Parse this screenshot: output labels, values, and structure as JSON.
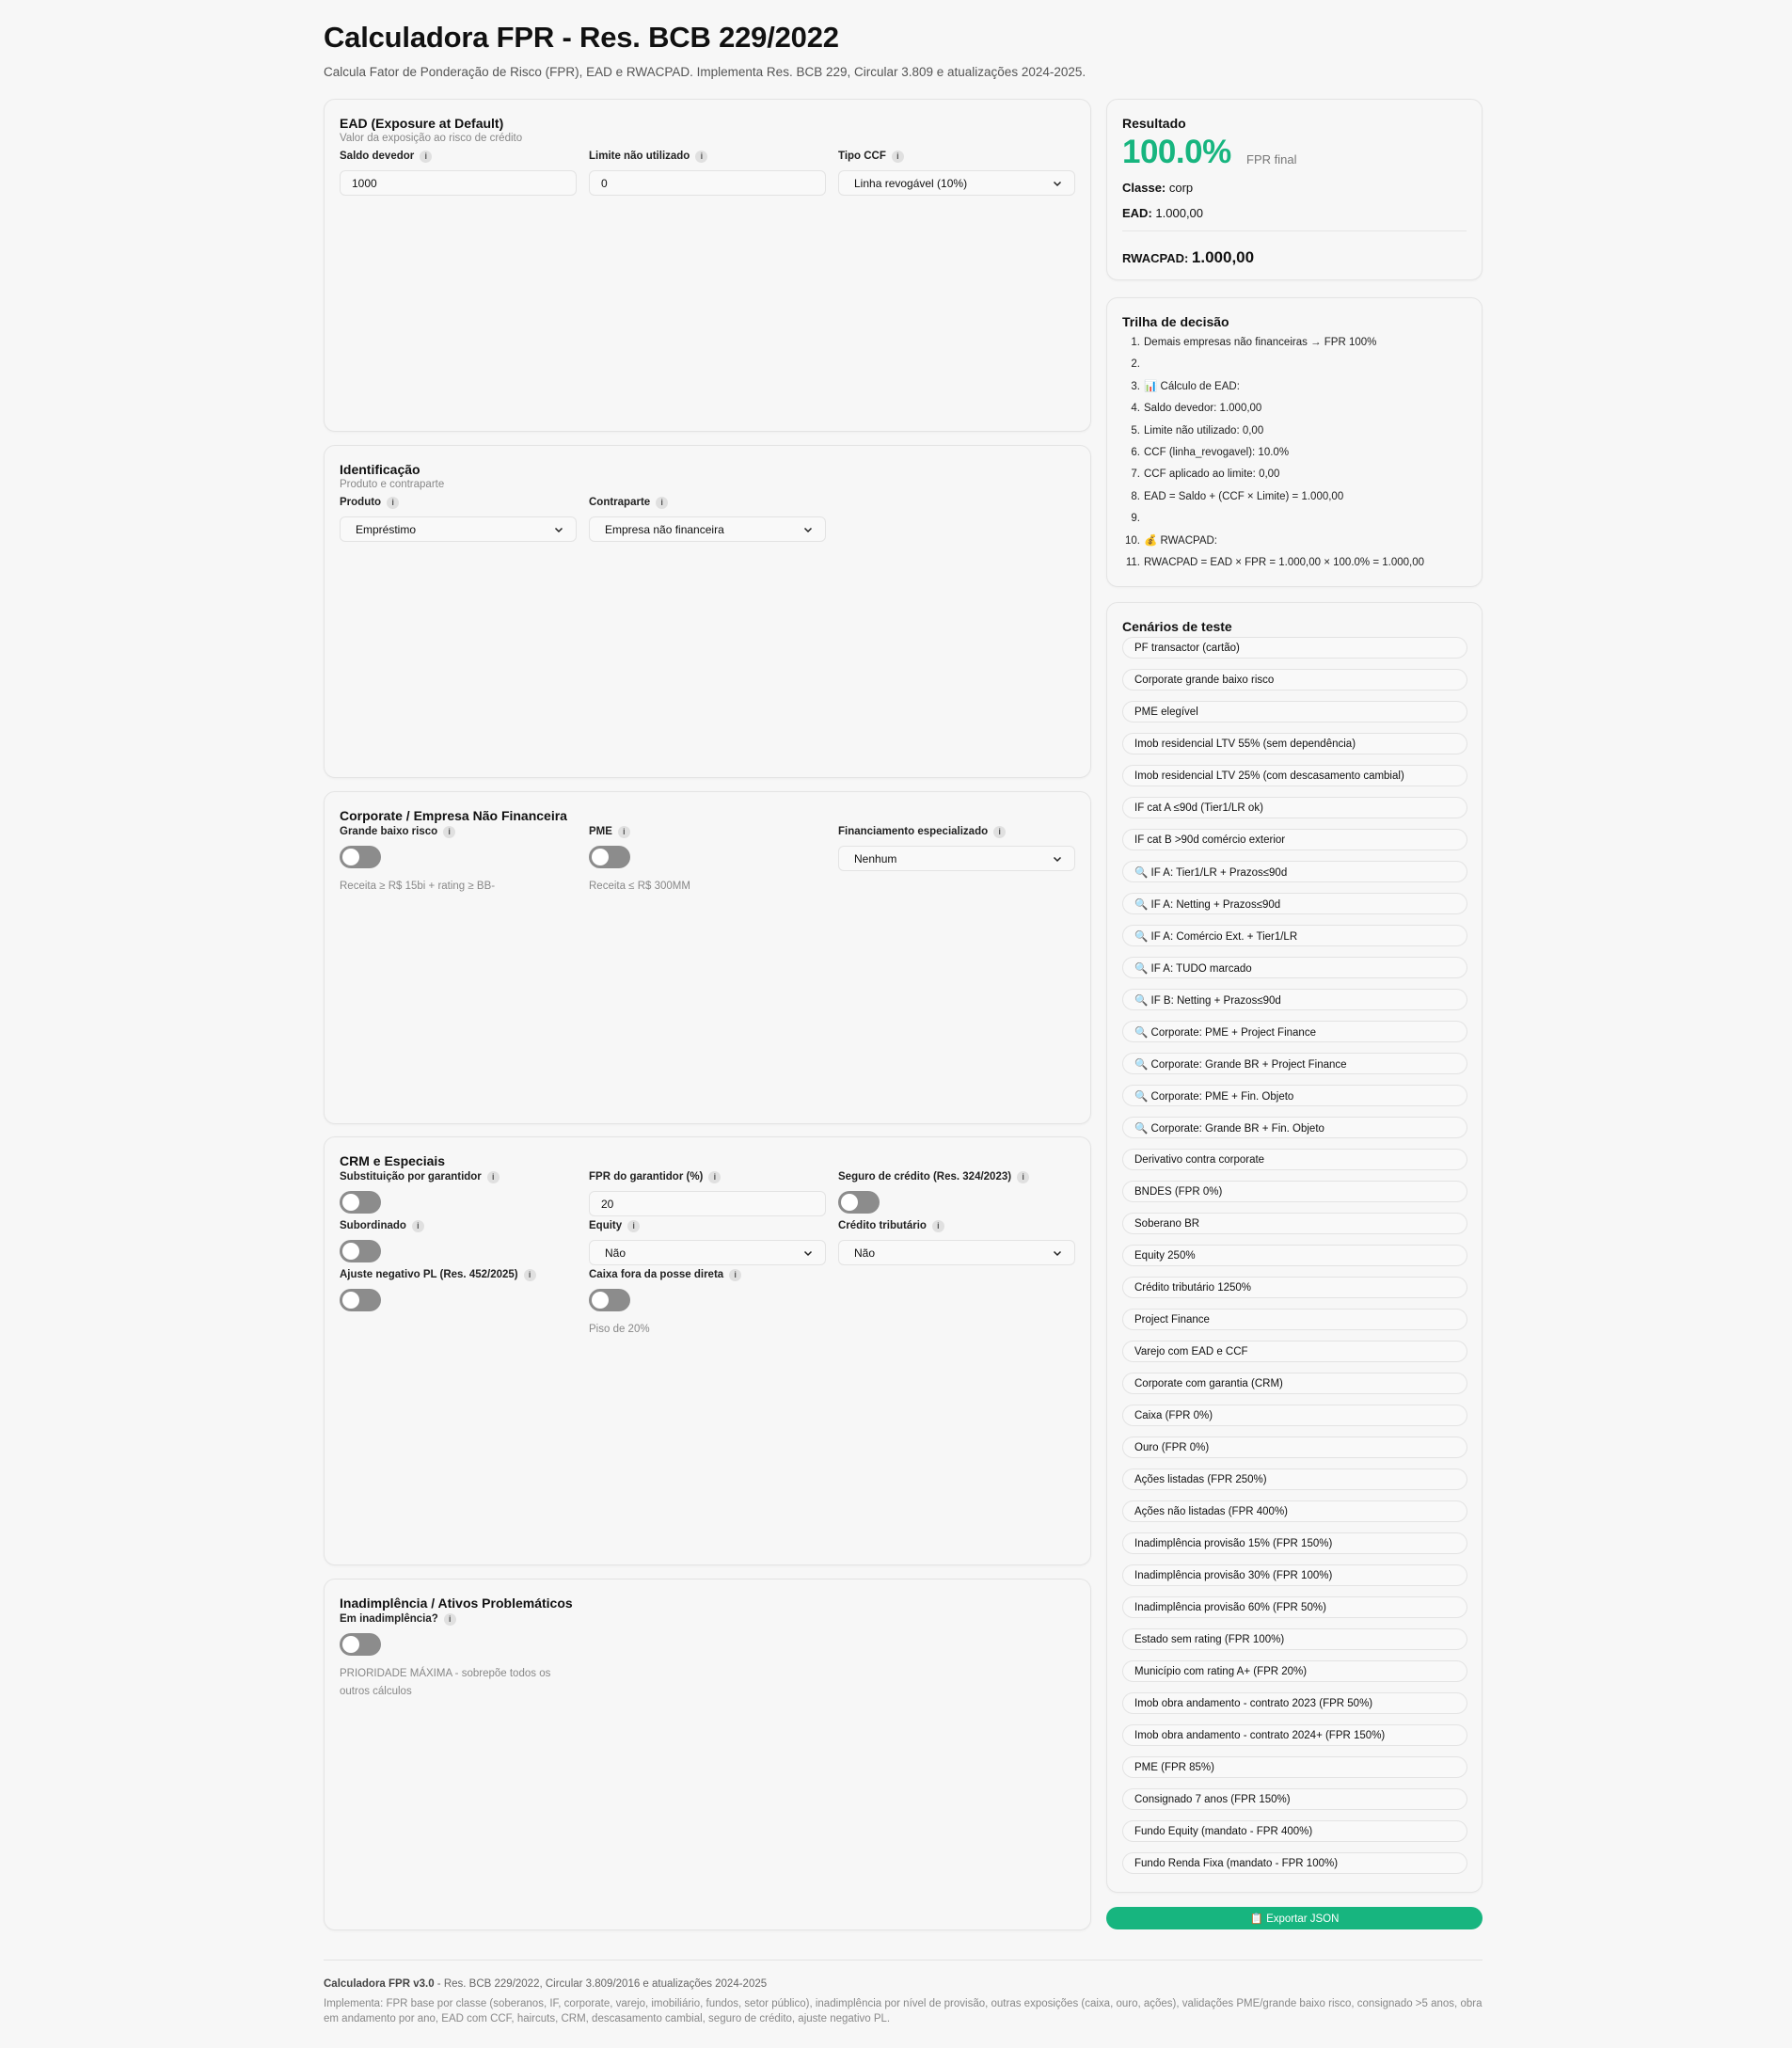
{
  "header": {
    "title": "Calculadora FPR - Res. BCB 229/2022",
    "subtitle": "Calcula Fator de Ponderação de Risco (FPR), EAD e RWACPAD. Implementa Res. BCB 229, Circular 3.809 e atualizações 2024-2025."
  },
  "ead": {
    "title": "EAD (Exposure at Default)",
    "subtitle": "Valor da exposição ao risco de crédito",
    "saldo_label": "Saldo devedor",
    "saldo_value": "1000",
    "limite_label": "Limite não utilizado",
    "limite_value": "0",
    "ccf_label": "Tipo CCF",
    "ccf_value": "Linha revogável (10%)"
  },
  "identificacao": {
    "title": "Identificação",
    "subtitle": "Produto e contraparte",
    "produto_label": "Produto",
    "produto_value": "Empréstimo",
    "contraparte_label": "Contraparte",
    "contraparte_value": "Empresa não financeira"
  },
  "corporate": {
    "title": "Corporate / Empresa Não Financeira",
    "gbr_label": "Grande baixo risco",
    "gbr_hint": "Receita ≥ R$ 15bi + rating ≥ BB-",
    "gbr_on": false,
    "pme_label": "PME",
    "pme_hint": "Receita ≤ R$ 300MM",
    "pme_on": false,
    "fin_label": "Financiamento especializado",
    "fin_value": "Nenhum"
  },
  "crm": {
    "title": "CRM e Especiais",
    "garantidor_label": "Substituição por garantidor",
    "fpr_garantidor_label": "FPR do garantidor (%)",
    "fpr_garantidor_value": "20",
    "seguro_label": "Seguro de crédito (Res. 324/2023)",
    "subordinado_label": "Subordinado",
    "equity_label": "Equity",
    "equity_value": "Não",
    "credito_label": "Crédito tributário",
    "credito_value": "Não",
    "ajuste_label": "Ajuste negativo PL (Res. 452/2025)",
    "caixa_label": "Caixa fora da posse direta",
    "caixa_hint": "Piso de 20%"
  },
  "inadimplencia": {
    "title": "Inadimplência / Ativos Problemáticos",
    "label": "Em inadimplência?",
    "hint": "PRIORIDADE MÁXIMA - sobrepõe todos os outros cálculos"
  },
  "resultado": {
    "title": "Resultado",
    "fpr": "100.0%",
    "fpr_note": "FPR final",
    "classe_label": "Classe:",
    "classe_value": "corp",
    "ead_label": "EAD:",
    "ead_value": "1.000,00",
    "rwacpad_label": "RWACPAD:",
    "rwacpad_value": "1.000,00"
  },
  "trilha": {
    "title": "Trilha de decisão",
    "steps": [
      {
        "n": "1.",
        "t": "Demais empresas não financeiras → FPR 100%"
      },
      {
        "n": "2.",
        "t": ""
      },
      {
        "n": "3.",
        "t": "📊 Cálculo de EAD:"
      },
      {
        "n": "4.",
        "t": "Saldo devedor: 1.000,00"
      },
      {
        "n": "5.",
        "t": "Limite não utilizado: 0,00"
      },
      {
        "n": "6.",
        "t": "CCF (linha_revogavel): 10.0%"
      },
      {
        "n": "7.",
        "t": "CCF aplicado ao limite: 0,00"
      },
      {
        "n": "8.",
        "t": "EAD = Saldo + (CCF × Limite) = 1.000,00"
      },
      {
        "n": "9.",
        "t": ""
      },
      {
        "n": "10.",
        "t": "💰 RWACPAD:"
      },
      {
        "n": "11.",
        "t": "RWACPAD = EAD × FPR = 1.000,00 × 100.0% = 1.000,00"
      }
    ]
  },
  "cenarios": {
    "title": "Cenários de teste",
    "items": [
      "PF transactor (cartão)",
      "Corporate grande baixo risco",
      "PME elegível",
      "Imob residencial LTV 55% (sem dependência)",
      "Imob residencial LTV 25% (com descasamento cambial)",
      "IF cat A ≤90d (Tier1/LR ok)",
      "IF cat B >90d comércio exterior",
      "🔍 IF A: Tier1/LR + Prazos≤90d",
      "🔍 IF A: Netting + Prazos≤90d",
      "🔍 IF A: Comércio Ext. + Tier1/LR",
      "🔍 IF A: TUDO marcado",
      "🔍 IF B: Netting + Prazos≤90d",
      "🔍 Corporate: PME + Project Finance",
      "🔍 Corporate: Grande BR + Project Finance",
      "🔍 Corporate: PME + Fin. Objeto",
      "🔍 Corporate: Grande BR + Fin. Objeto",
      "Derivativo contra corporate",
      "BNDES (FPR 0%)",
      "Soberano BR",
      "Equity 250%",
      "Crédito tributário 1250%",
      "Project Finance",
      "Varejo com EAD e CCF",
      "Corporate com garantia (CRM)",
      "Caixa (FPR 0%)",
      "Ouro (FPR 0%)",
      "Ações listadas (FPR 250%)",
      "Ações não listadas (FPR 400%)",
      "Inadimplência provisão 15% (FPR 150%)",
      "Inadimplência provisão 30% (FPR 100%)",
      "Inadimplência provisão 60% (FPR 50%)",
      "Estado sem rating (FPR 100%)",
      "Município com rating A+ (FPR 20%)",
      "Imob obra andamento - contrato 2023 (FPR 50%)",
      "Imob obra andamento - contrato 2024+ (FPR 150%)",
      "PME (FPR 85%)",
      "Consignado 7 anos (FPR 150%)",
      "Fundo Equity (mandato - FPR 400%)",
      "Fundo Renda Fixa (mandato - FPR 100%)"
    ]
  },
  "export_label": "📋 Exportar JSON",
  "footer": {
    "version": "Calculadora FPR v3.0",
    "line1": " - Res. BCB 229/2022, Circular 3.809/2016 e atualizações 2024-2025",
    "line2": "Implementa: FPR base por classe (soberanos, IF, corporate, varejo, imobiliário, fundos, setor público), inadimplência por nível de provisão, outras exposições (caixa, ouro, ações), validações PME/grande baixo risco, consignado >5 anos, obra em andamento por ano, EAD com CCF, haircuts, CRM, descasamento cambial, seguro de crédito, ajuste negativo PL."
  },
  "colors": {
    "accent": "#17b57f",
    "toggle_off": "#8c8c8c"
  },
  "icons": {
    "info": "info-icon",
    "chevron": "chevron-down-icon"
  }
}
